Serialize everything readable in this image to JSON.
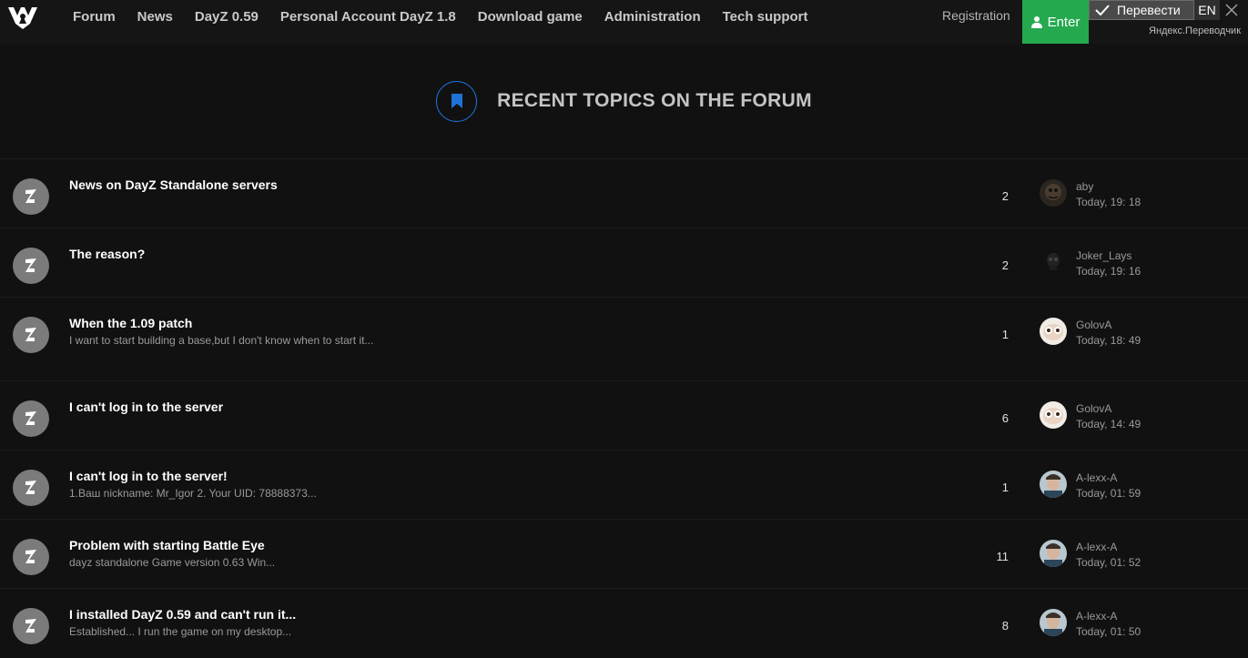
{
  "nav": {
    "items": [
      "Forum",
      "News",
      "DayZ 0.59",
      "Personal Account DayZ 1.8",
      "Download game",
      "Administration",
      "Tech support"
    ],
    "registration": "Registration",
    "enter": "Enter"
  },
  "translate": {
    "button": "Перевести",
    "lang": "EN",
    "provider": "Яндекс.Переводчик"
  },
  "section": {
    "title": "RECENT TOPICS ON THE FORUM"
  },
  "topics": [
    {
      "title": "News on DayZ Standalone servers",
      "snippet": "",
      "count": "2",
      "user": "aby",
      "time": "Today, 19: 18",
      "avatar_style": "dark"
    },
    {
      "title": "The reason?",
      "snippet": "",
      "count": "2",
      "user": "Joker_Lays",
      "time": "Today, 19: 16",
      "avatar_style": "skull"
    },
    {
      "title": "When the 1.09 patch",
      "snippet": "I want to start building a base,but I don't know when to start it...",
      "count": "1",
      "user": "GolovA",
      "time": "Today, 18: 49",
      "avatar_style": "light"
    },
    {
      "title": "I can't log in to the server",
      "snippet": "",
      "count": "6",
      "user": "GolovA",
      "time": "Today, 14: 49",
      "avatar_style": "light"
    },
    {
      "title": "I can't log in to the server!",
      "snippet": "1.Ваш nickname: Mr_Igor 2. Your UID: 78888373...",
      "count": "1",
      "user": "A-lexx-A",
      "time": "Today, 01: 59",
      "avatar_style": "photo"
    },
    {
      "title": "Problem with starting Battle Eye",
      "snippet": "dayz standalone Game version 0.63 Win...",
      "count": "11",
      "user": "A-lexx-A",
      "time": "Today, 01: 52",
      "avatar_style": "photo"
    },
    {
      "title": "I installed DayZ 0.59 and can't run it...",
      "snippet": "Established... I run the game on my desktop...",
      "count": "8",
      "user": "A-lexx-A",
      "time": "Today, 01: 50",
      "avatar_style": "photo"
    }
  ],
  "colors": {
    "background": "#111112",
    "enter_button": "#25a94f",
    "accent_blue": "#1e72d8"
  }
}
